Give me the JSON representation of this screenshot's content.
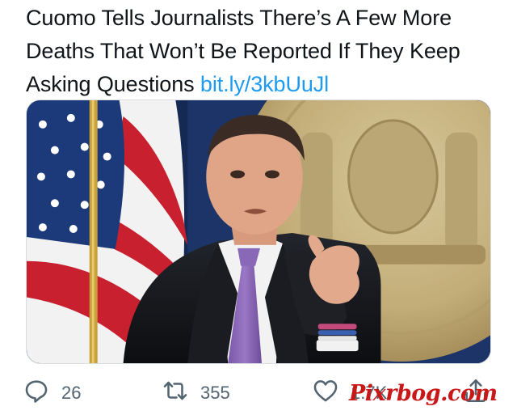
{
  "tweet": {
    "text_lines": [
      "Cuomo Tells Journalists There’s A Few More",
      "Deaths That Won’t Be Reported If They Keep",
      "Asking Questions"
    ],
    "link": "bit.ly/3kbUuJl"
  },
  "media": {
    "subject_icon": "man-pointing-at-camera-photo",
    "background_items": [
      "american-flag",
      "new-york-state-seal"
    ]
  },
  "actions": {
    "reply": {
      "icon": "reply-icon",
      "count": "26"
    },
    "retweet": {
      "icon": "retweet-icon",
      "count": "355"
    },
    "like": {
      "icon": "heart-icon",
      "count": "1.7K"
    },
    "share": {
      "icon": "share-icon"
    }
  },
  "watermark": "Pixrbog.com",
  "colors": {
    "text": "#0f1419",
    "link": "#1d9bf0",
    "action_gray": "#536471",
    "watermark_red": "#c81818"
  }
}
